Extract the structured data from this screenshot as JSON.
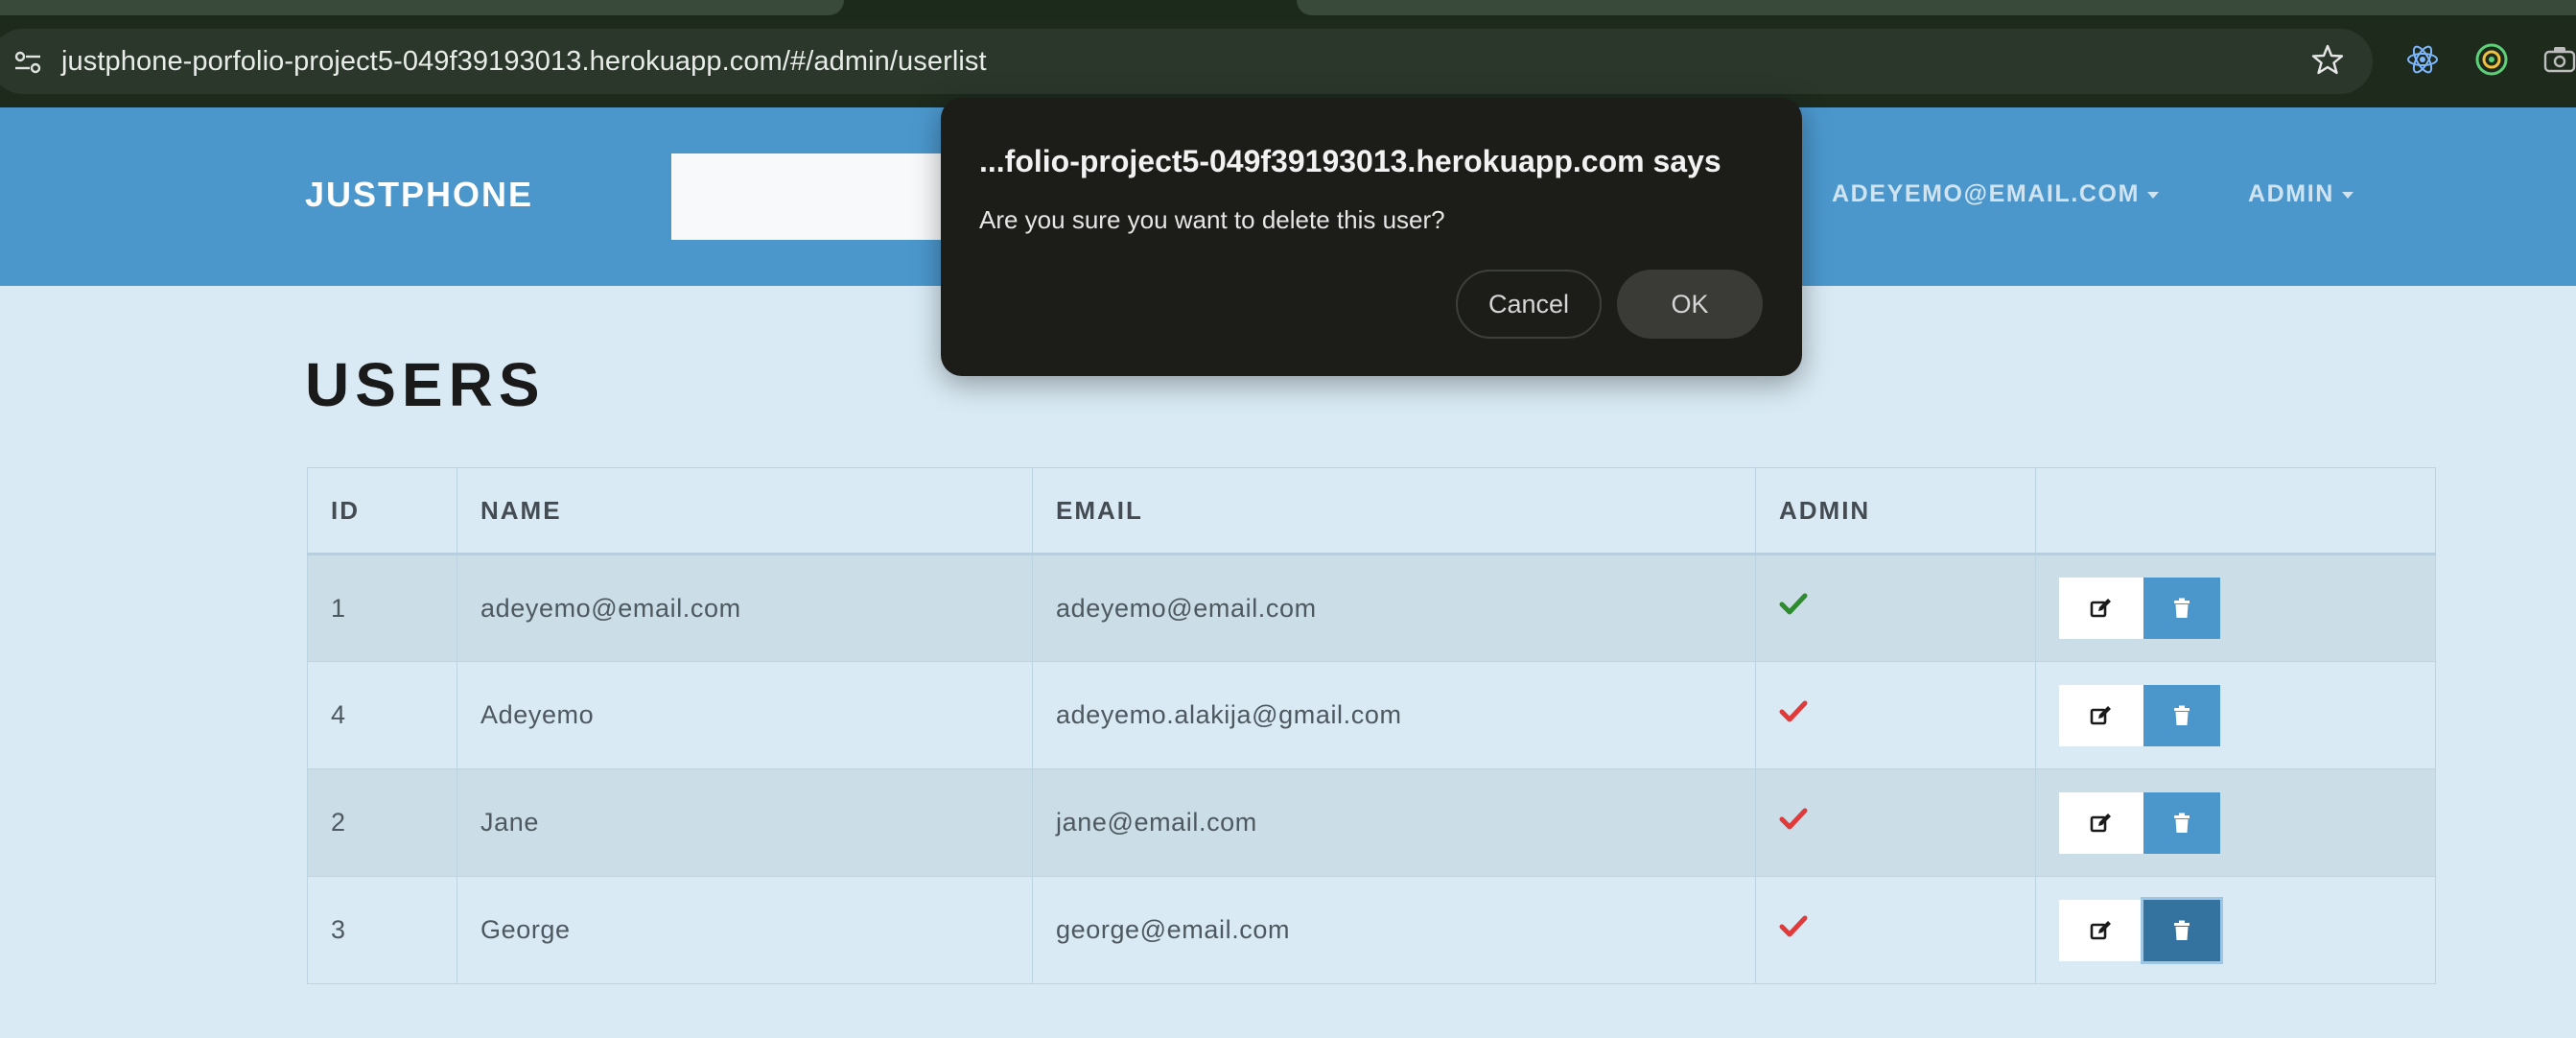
{
  "browser": {
    "url": "justphone-porfolio-project5-049f39193013.herokuapp.com/#/admin/userlist"
  },
  "navbar": {
    "brand": "JUSTPHONE",
    "search_placeholder": "",
    "user_menu_label": "ADEYEMO@EMAIL.COM",
    "admin_menu_label": "ADMIN"
  },
  "page": {
    "title": "USERS"
  },
  "table": {
    "headers": [
      "ID",
      "NAME",
      "EMAIL",
      "ADMIN",
      ""
    ],
    "rows": [
      {
        "id": "1",
        "name": "adeyemo@email.com",
        "email": "adeyemo@email.com",
        "admin_icon": "check-icon",
        "check_color": "#2e8b2e"
      },
      {
        "id": "4",
        "name": "Adeyemo",
        "email": "adeyemo.alakija@gmail.com",
        "admin_icon": "check-icon",
        "check_color": "#e03a3a"
      },
      {
        "id": "2",
        "name": "Jane",
        "email": "jane@email.com",
        "admin_icon": "check-icon",
        "check_color": "#e03a3a"
      },
      {
        "id": "3",
        "name": "George",
        "email": "george@email.com",
        "admin_icon": "check-icon",
        "check_color": "#e03a3a"
      }
    ]
  },
  "dialog": {
    "title": "...folio-project5-049f39193013.herokuapp.com says",
    "message": "Are you sure you want to delete this user?",
    "cancel_label": "Cancel",
    "ok_label": "OK"
  },
  "colors": {
    "navbar_bg": "#4b97cc",
    "page_bg": "#d9eaf4",
    "dialog_bg": "#1c1d19",
    "delete_button": "#4b97cc"
  }
}
